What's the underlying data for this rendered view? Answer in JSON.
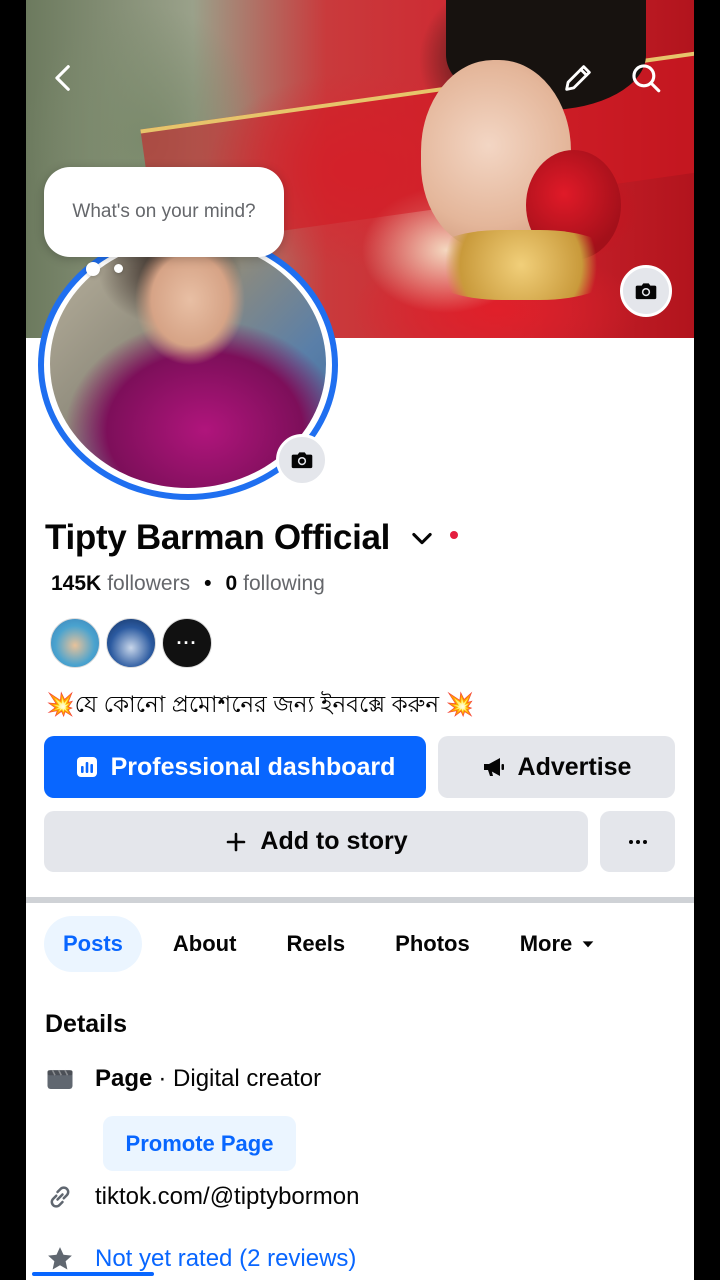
{
  "profile": {
    "bubble_text": "What's on your mind?",
    "name": "Tipty Barman Official",
    "followers_count": "145K",
    "followers_label": "followers",
    "following_count": "0",
    "following_label": "following",
    "separator": "•",
    "friends_more": "···",
    "bio": "💥যে কোনো প্রমোশনের জন্য ইনবক্সে করুন 💥"
  },
  "actions": {
    "dashboard_label": "Professional dashboard",
    "advertise_label": "Advertise",
    "add_story_label": "Add to story"
  },
  "tabs": [
    {
      "label": "Posts"
    },
    {
      "label": "About"
    },
    {
      "label": "Reels"
    },
    {
      "label": "Photos"
    },
    {
      "label": "More"
    }
  ],
  "details": {
    "title": "Details",
    "page_type": "Page",
    "page_category": "· Digital creator",
    "promote_label": "Promote Page",
    "link": "tiktok.com/@tiptybormon",
    "rating": "Not yet rated (2 reviews)"
  },
  "colors": {
    "accent": "#0866ff",
    "avatar_ring": "#1f6ff0",
    "button_gray": "#e4e6eb",
    "tab_active_bg": "#ebf5ff"
  },
  "icons": {
    "back": "chevron-left-icon",
    "edit": "pencil-icon",
    "search": "search-icon",
    "camera": "camera-icon",
    "dashboard": "bar-chart-icon",
    "advertise": "megaphone-icon",
    "add": "plus-icon",
    "more": "ellipsis-icon",
    "page": "clapperboard-icon",
    "link": "link-icon",
    "rating": "star-icon"
  }
}
